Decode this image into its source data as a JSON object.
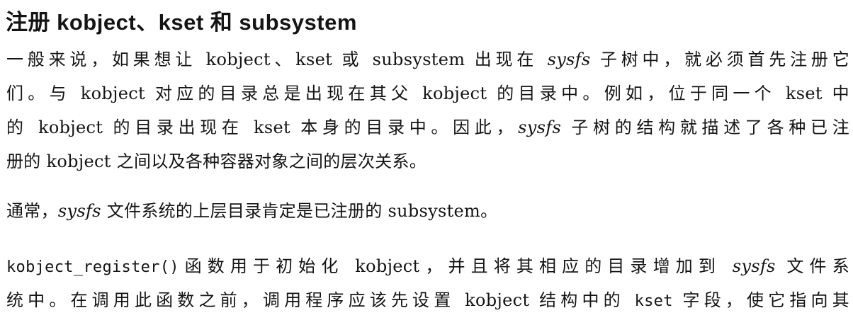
{
  "heading": "注册 kobject、kset 和 subsystem",
  "paragraph1": {
    "line1": [
      "一般来说，如果想让 kobject、kset 或 subsystem 出现在 ",
      "sysfs",
      " 子树中，就必须首先注册它"
    ],
    "line2": "们。与 kobject 对应的目录总是出现在其父 kobject 的目录中。例如，位于同一个 kset 中",
    "line3": [
      "的 kobject 的目录出现在 kset 本身的目录中。因此，",
      "sysfs",
      " 子树的结构就描述了各种已注"
    ],
    "line4": "册的 kobject 之间以及各种容器对象之间的层次关系。"
  },
  "paragraph2": {
    "line1": [
      "通常，",
      "sysfs",
      " 文件系统的上层目录肯定是已注册的 subsystem。"
    ]
  },
  "paragraph3": {
    "line1": [
      "kobject_register()",
      "函数用于初始化 kobject，并且将其相应的目录增加到 ",
      "sysfs",
      " 文件系"
    ],
    "line2": [
      "统中。在调用此函数之前，调用程序应该先设置 kobject 结构中的 ",
      "kset",
      " 字段，使它指向其"
    ]
  }
}
